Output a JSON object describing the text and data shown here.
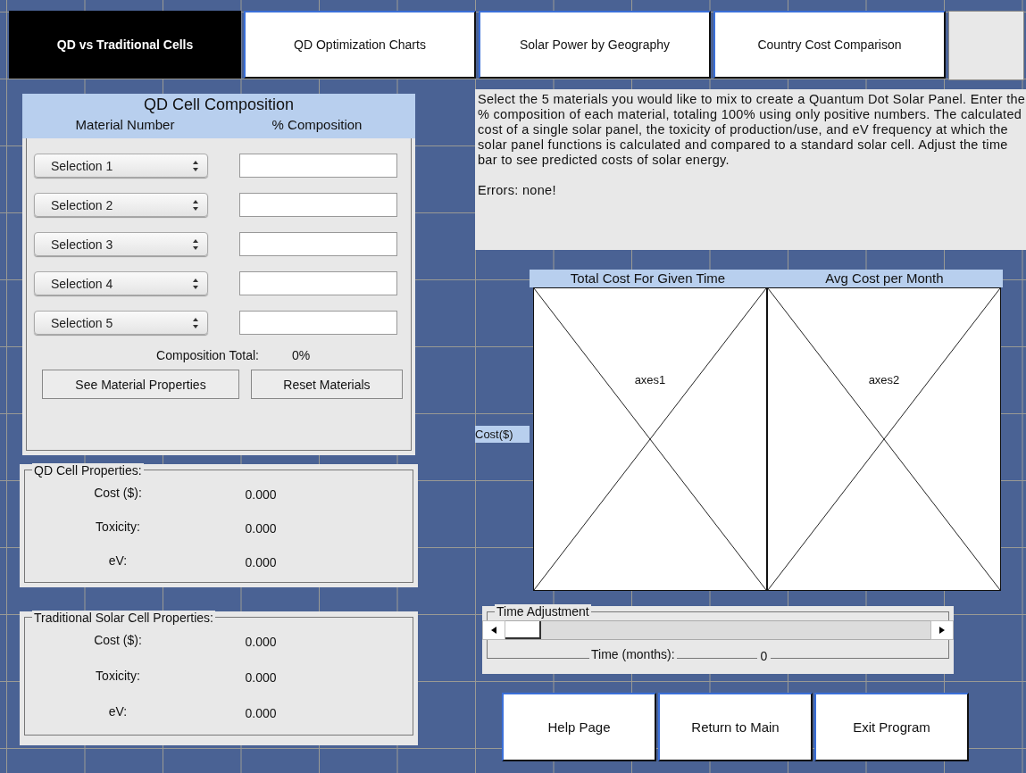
{
  "tabs": [
    {
      "label": "QD vs Traditional Cells",
      "selected": true
    },
    {
      "label": "QD Optimization Charts",
      "selected": false
    },
    {
      "label": "Solar Power by Geography",
      "selected": false
    },
    {
      "label": "Country Cost Comparison",
      "selected": false
    }
  ],
  "composition": {
    "title": "QD Cell Composition",
    "columns": [
      "Material Number",
      "% Composition"
    ],
    "rows": [
      {
        "selection": "Selection 1"
      },
      {
        "selection": "Selection 2"
      },
      {
        "selection": "Selection 3"
      },
      {
        "selection": "Selection 4"
      },
      {
        "selection": "Selection 5"
      }
    ],
    "total_label": "Composition Total:",
    "total_value": "0%",
    "buttons": [
      "See Material Properties",
      "Reset Materials"
    ]
  },
  "qd_properties": {
    "title": "QD Cell Properties:",
    "rows": [
      {
        "label": "Cost ($):",
        "value": "0.000"
      },
      {
        "label": "Toxicity:",
        "value": "0.000"
      },
      {
        "label": "eV:",
        "value": "0.000"
      }
    ]
  },
  "traditional_properties": {
    "title": "Traditional Solar Cell Properties:",
    "rows": [
      {
        "label": "Cost ($):",
        "value": "0.000"
      },
      {
        "label": "Toxicity:",
        "value": "0.000"
      },
      {
        "label": "eV:",
        "value": "0.000"
      }
    ]
  },
  "instructions": {
    "text": "Select the 5 materials you would like to mix to create a Quantum Dot Solar Panel. Enter the % composition of each material, totaling 100% using only positive numbers. The calculated cost of a single solar panel, the toxicity of production/use, and eV frequency at which the solar panel functions is calculated and compared to a standard solar cell. Adjust the time bar to see predicted costs of solar energy.",
    "errors": "Errors: none!"
  },
  "charts": {
    "y_label": "Cost($)",
    "axes": [
      {
        "title": "Total Cost For Given Time",
        "name": "axes1"
      },
      {
        "title": "Avg Cost per Month",
        "name": "axes2"
      }
    ]
  },
  "time_adjustment": {
    "title": "Time Adjustment",
    "level": 0,
    "label": "Time (months):",
    "value": "0"
  },
  "buttons": [
    "Help Page",
    "Return to Main",
    "Exit Program"
  ]
}
